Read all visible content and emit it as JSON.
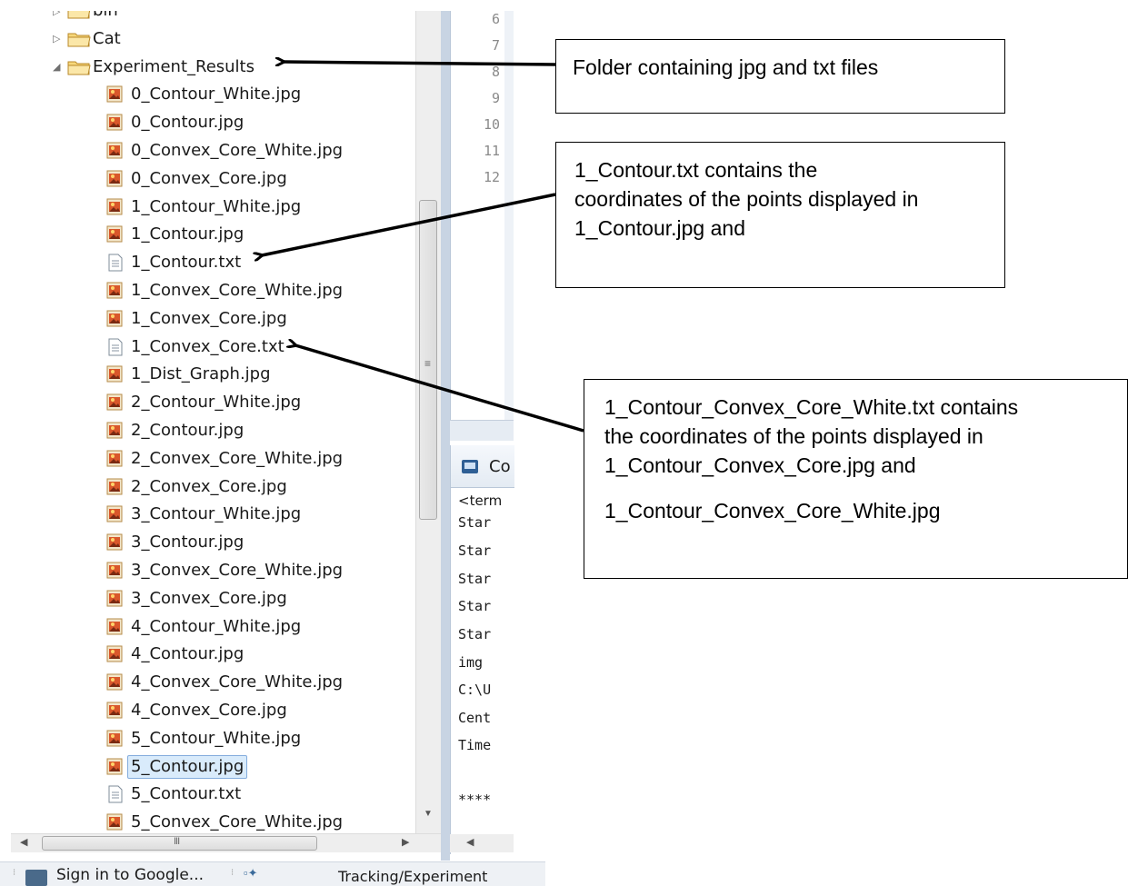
{
  "tree": {
    "items": [
      {
        "label": "bin",
        "kind": "folder",
        "expander": "collapsed"
      },
      {
        "label": "Cat",
        "kind": "folder",
        "expander": "collapsed"
      },
      {
        "label": "Experiment_Results",
        "kind": "folder",
        "expander": "expanded"
      },
      {
        "label": "0_Contour_White.jpg",
        "kind": "jpg"
      },
      {
        "label": "0_Contour.jpg",
        "kind": "jpg"
      },
      {
        "label": "0_Convex_Core_White.jpg",
        "kind": "jpg"
      },
      {
        "label": "0_Convex_Core.jpg",
        "kind": "jpg"
      },
      {
        "label": "1_Contour_White.jpg",
        "kind": "jpg"
      },
      {
        "label": "1_Contour.jpg",
        "kind": "jpg"
      },
      {
        "label": "1_Contour.txt",
        "kind": "txt"
      },
      {
        "label": "1_Convex_Core_White.jpg",
        "kind": "jpg"
      },
      {
        "label": "1_Convex_Core.jpg",
        "kind": "jpg"
      },
      {
        "label": "1_Convex_Core.txt",
        "kind": "txt"
      },
      {
        "label": "1_Dist_Graph.jpg",
        "kind": "jpg"
      },
      {
        "label": "2_Contour_White.jpg",
        "kind": "jpg"
      },
      {
        "label": "2_Contour.jpg",
        "kind": "jpg"
      },
      {
        "label": "2_Convex_Core_White.jpg",
        "kind": "jpg"
      },
      {
        "label": "2_Convex_Core.jpg",
        "kind": "jpg"
      },
      {
        "label": "3_Contour_White.jpg",
        "kind": "jpg"
      },
      {
        "label": "3_Contour.jpg",
        "kind": "jpg"
      },
      {
        "label": "3_Convex_Core_White.jpg",
        "kind": "jpg"
      },
      {
        "label": "3_Convex_Core.jpg",
        "kind": "jpg"
      },
      {
        "label": "4_Contour_White.jpg",
        "kind": "jpg"
      },
      {
        "label": "4_Contour.jpg",
        "kind": "jpg"
      },
      {
        "label": "4_Convex_Core_White.jpg",
        "kind": "jpg"
      },
      {
        "label": "4_Convex_Core.jpg",
        "kind": "jpg"
      },
      {
        "label": "5_Contour_White.jpg",
        "kind": "jpg"
      },
      {
        "label": "5_Contour.jpg",
        "kind": "jpg",
        "selected": true
      },
      {
        "label": "5_Contour.txt",
        "kind": "txt"
      },
      {
        "label": "5_Convex_Core_White.jpg",
        "kind": "jpg"
      }
    ]
  },
  "editor": {
    "line_numbers": [
      "6",
      "7",
      "8",
      "9",
      "10",
      "11",
      "12"
    ]
  },
  "console": {
    "tab_label": "Co",
    "terminated_label": "<term",
    "lines": [
      "Star",
      "Star",
      "Star",
      "Star",
      "Star",
      "img",
      "C:\\U",
      "Cent",
      "Time",
      "",
      "****"
    ]
  },
  "statusbar": {
    "google_label": "Sign in to Google...",
    "path_label": "Tracking/Experiment"
  },
  "callouts": {
    "folder": "Folder containing jpg and txt files",
    "contour_txt": [
      "1_Contour.txt contains the",
      "coordinates of the points displayed in",
      "1_Contour.jpg  and"
    ],
    "convex_txt": [
      "1_Contour_Convex_Core_White.txt contains",
      "the coordinates of the points displayed in",
      "1_Contour_Convex_Core.jpg and",
      "1_Contour_Convex_Core_White.jpg"
    ]
  },
  "colors": {
    "selection_bg": "#d9ebfb",
    "selection_border": "#84acdd",
    "folder_fill": "#f6d77a",
    "jpg_icon": "#d9572b",
    "panel_border": "#c8d4e3"
  }
}
